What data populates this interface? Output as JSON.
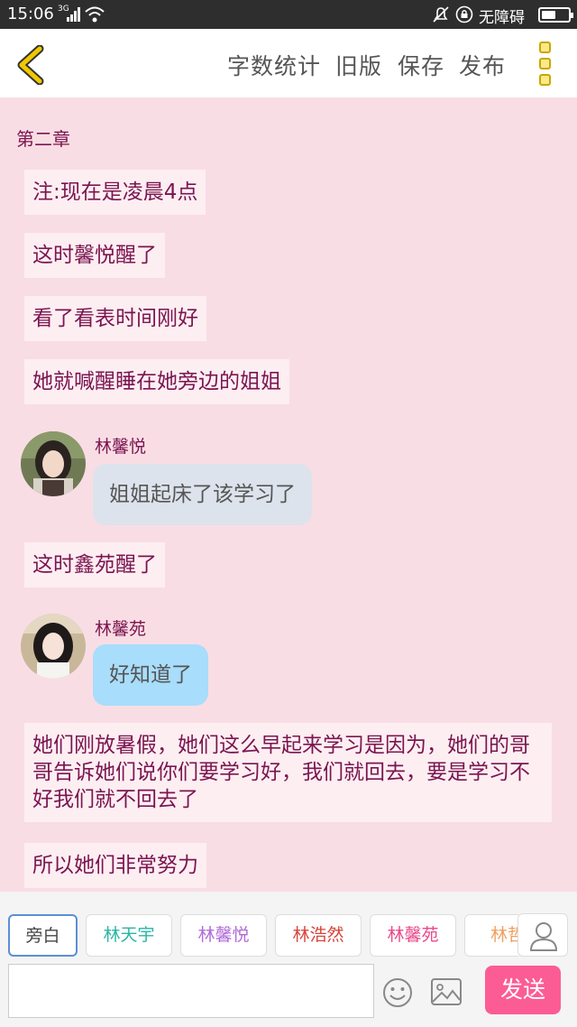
{
  "status_bar": {
    "time": "15:06",
    "network": "3G",
    "accessibility": "无障碍",
    "battery_level": 0.55,
    "icons": [
      "signal-icon",
      "wifi-icon",
      "bell-off-icon",
      "circle-lock-icon",
      "battery-icon"
    ]
  },
  "header": {
    "buttons": [
      "字数统计",
      "旧版",
      "保存",
      "发布"
    ],
    "icons": [
      "back-chevron-icon",
      "menu-dots-icon"
    ],
    "accent": "#f0c800"
  },
  "content": {
    "chapter": "第二章",
    "narr1": "注:现在是凌晨4点",
    "narr2": "这时馨悦醒了",
    "narr3": "看了看表时间刚好",
    "narr4": "她就喊醒睡在她旁边的姐姐",
    "msg1": {
      "name": "林馨悦",
      "text": "姐姐起床了该学习了",
      "color": "#dde3ec"
    },
    "narr5": "这时鑫苑醒了",
    "msg2": {
      "name": "林馨苑",
      "text": "好知道了",
      "color": "#a8ddfb"
    },
    "narr6": "她们刚放暑假，她们这么早起来学习是因为，她们的哥哥告诉她们说你们要学习好，我们就回去，要是学习不好我们就不回去了",
    "narr7": "所以她们非常努力"
  },
  "bottom": {
    "chips": [
      {
        "label": "旁白",
        "color": "#444444"
      },
      {
        "label": "林天宇",
        "color": "#2bb5a5"
      },
      {
        "label": "林馨悦",
        "color": "#b06ad8"
      },
      {
        "label": "林浩然",
        "color": "#d8443a"
      },
      {
        "label": "林馨苑",
        "color": "#e84a8c"
      },
      {
        "label": "林哲",
        "color": "#f0a060"
      }
    ],
    "input_value": "",
    "send_label": "发送",
    "send_color": "#fb5c94",
    "icons": [
      "person-icon",
      "smile-icon",
      "image-icon"
    ]
  }
}
